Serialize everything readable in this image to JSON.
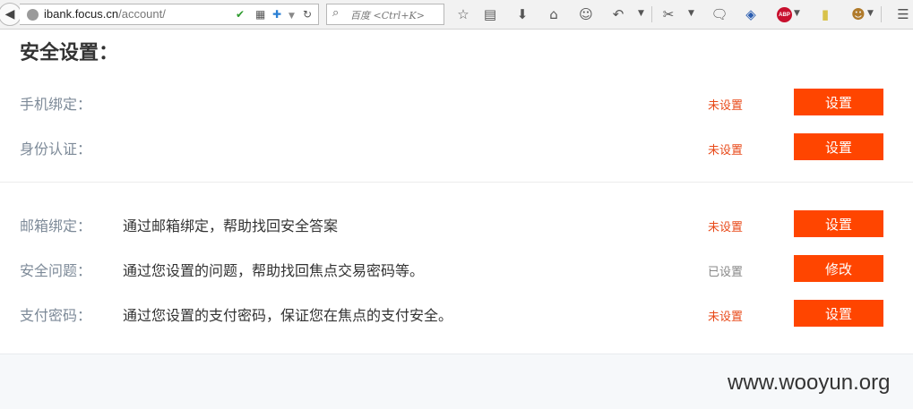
{
  "browser": {
    "url_host": "ibank.focus.cn",
    "url_path": "/account/",
    "search_placeholder": "百度 <Ctrl+K>",
    "icons": [
      "back-icon",
      "globe-icon",
      "shield-icon",
      "qr-icon",
      "plus-icon",
      "dropdown-icon",
      "reload-icon",
      "search-icon",
      "bookmark-star-icon",
      "clipboard-icon",
      "download-icon",
      "home-icon",
      "chat-icon",
      "undo-icon",
      "crop-icon",
      "speech-icon",
      "security-shield-icon",
      "adblock-icon",
      "note-icon",
      "monkey-icon",
      "menu-icon"
    ],
    "adblock_label": "ABP"
  },
  "page": {
    "section_title": "安全设置："
  },
  "security_items": [
    {
      "label": "手机绑定：",
      "description": "",
      "status": "未设置",
      "status_type": "unset",
      "button": "设置"
    },
    {
      "label": "身份认证：",
      "description": "",
      "status": "未设置",
      "status_type": "unset",
      "button": "设置"
    },
    {
      "label": "邮箱绑定：",
      "description": "通过邮箱绑定，帮助找回安全答案",
      "status": "未设置",
      "status_type": "unset",
      "button": "设置"
    },
    {
      "label": "安全问题：",
      "description": "通过您设置的问题，帮助找回焦点交易密码等。",
      "status": "已设置",
      "status_type": "set",
      "button": "修改"
    },
    {
      "label": "支付密码：",
      "description": "通过您设置的支付密码，保证您在焦点的支付安全。",
      "status": "未设置",
      "status_type": "unset",
      "button": "设置"
    }
  ],
  "colors": {
    "button_bg": "#ff4500",
    "status_unset": "#e84a1a",
    "status_set": "#888888",
    "label": "#7d8a98"
  },
  "watermark": "www.wooyun.org"
}
